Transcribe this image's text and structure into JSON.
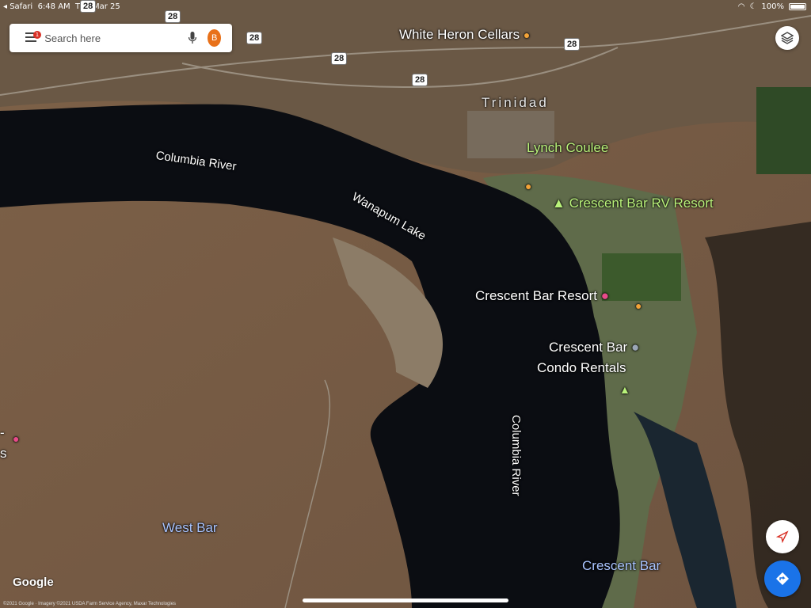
{
  "status_bar": {
    "carrier": "◂ Safari",
    "time": "6:48 AM",
    "date": "Thu Mar 25",
    "battery": "100%"
  },
  "search": {
    "placeholder": "Search here",
    "notification_count": "1",
    "avatar_letter": "B"
  },
  "highways": [
    "28",
    "28",
    "28",
    "28",
    "28",
    "28"
  ],
  "labels": {
    "white_heron": "White Heron Cellars",
    "trinidad": "Trinidad",
    "lynch_coulee": "Lynch Coulee",
    "columbia_river_north": "Columbia River",
    "wanapum_lake": "Wanapum Lake",
    "rv_resort": "Crescent Bar RV Resort",
    "resort": "Crescent Bar Resort",
    "condo_line1": "Crescent Bar",
    "condo_line2": "Condo Rentals",
    "columbia_river_south": "Columbia River",
    "west_bar": "West Bar",
    "crescent_bar": "Crescent Bar",
    "edge_fragment_1": "-",
    "edge_fragment_2": "s"
  },
  "branding": {
    "logo": "Google",
    "attribution": "©2021 Google · Imagery ©2021 USDA Farm Service Agency, Maxar Technologies"
  },
  "icons": [
    "menu-icon",
    "mic-icon",
    "layers-icon",
    "compass-icon",
    "directions-icon",
    "wine-icon",
    "restaurant-icon",
    "campground-icon",
    "hotel-icon",
    "location-icon"
  ],
  "colors": {
    "water": "#0b0d12",
    "land": "#7b5f45",
    "directions": "#1a73e8",
    "avatar": "#e8711a",
    "green_label": "#b9f27a"
  }
}
